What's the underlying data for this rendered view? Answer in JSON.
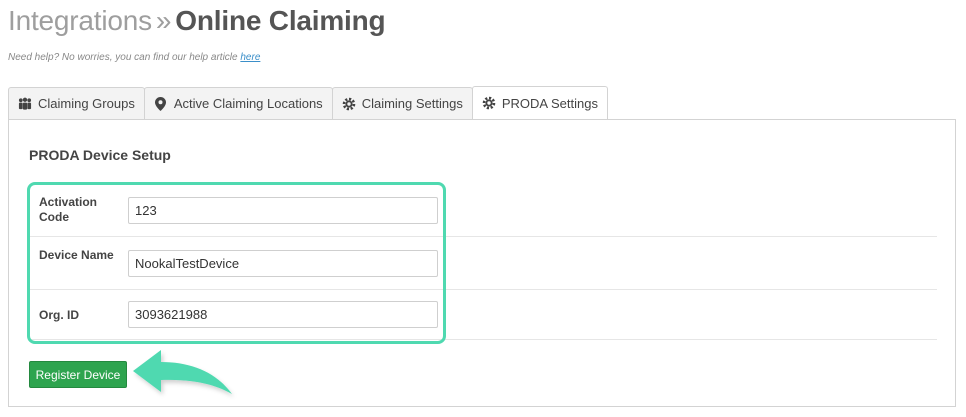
{
  "header": {
    "crumb": "Integrations",
    "separator": "»",
    "title": "Online Claiming",
    "help_text": "Need help? No worries, you can find our help article ",
    "help_link": "here"
  },
  "tabs": [
    {
      "label": "Claiming Groups",
      "icon": "group-icon",
      "active": false
    },
    {
      "label": "Active Claiming Locations",
      "icon": "map-marker-icon",
      "active": false
    },
    {
      "label": "Claiming Settings",
      "icon": "gear-icon",
      "active": false
    },
    {
      "label": "PRODA Settings",
      "icon": "gear-icon",
      "active": true
    }
  ],
  "section": {
    "title": "PRODA Device Setup"
  },
  "form": {
    "activation_code": {
      "label": "Activation Code",
      "value": "123"
    },
    "device_name": {
      "label": "Device Name",
      "value": "NookalTestDevice"
    },
    "org_id": {
      "label": "Org. ID",
      "value": "3093621988"
    }
  },
  "actions": {
    "register_label": "Register Device"
  },
  "colors": {
    "highlight": "#4fd9b0",
    "button": "#2ea44f",
    "link": "#3b8fc9"
  }
}
